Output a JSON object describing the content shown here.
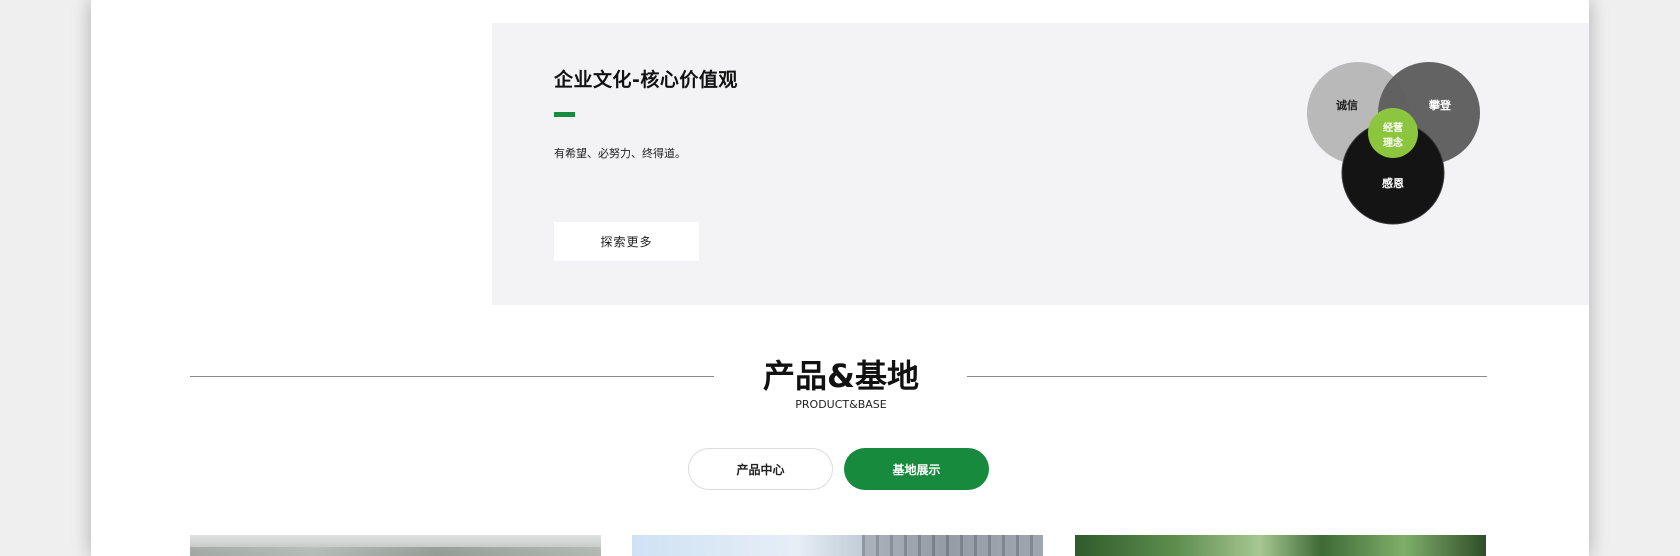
{
  "culture": {
    "title": "企业文化-核心价值观",
    "description": "有希望、必努力、终得道。",
    "explore_button": "探索更多",
    "venn": {
      "top_left": "诚信",
      "top_right": "攀登",
      "bottom": "感恩",
      "center_line1": "经营",
      "center_line2": "理念",
      "colors": {
        "top_left": "#b9b9b9",
        "top_right": "#5e5e5e",
        "bottom": "#141414",
        "center": "#8cc63f"
      }
    }
  },
  "products_section": {
    "title": "产品&基地",
    "subtitle": "PRODUCT&BASE",
    "tabs": [
      {
        "label": "产品中心",
        "active": false
      },
      {
        "label": "基地展示",
        "active": true
      }
    ]
  },
  "colors": {
    "accent": "#168c3f",
    "panel_bg": "#f3f3f5",
    "page_bg": "#efefef"
  }
}
